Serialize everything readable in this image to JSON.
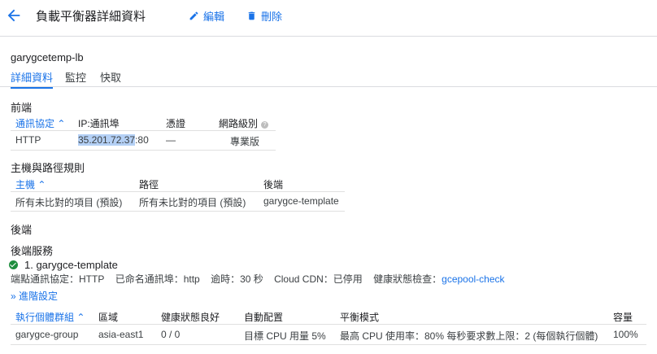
{
  "header": {
    "title": "負載平衡器詳細資料",
    "edit_label": "編輯",
    "delete_label": "刪除"
  },
  "lb_name": "garygcetemp-lb",
  "tabs": [
    "詳細資料",
    "監控",
    "快取"
  ],
  "frontend": {
    "heading": "前端",
    "columns": [
      "通訊協定",
      "IP:通訊埠",
      "憑證",
      "網路級別"
    ],
    "row": {
      "protocol": "HTTP",
      "ip": "35.201.72.37",
      "port": ":80",
      "cert": "—",
      "tier": "專業版"
    }
  },
  "host_rules": {
    "heading": "主機與路徑規則",
    "columns": [
      "主機",
      "路徑",
      "後端"
    ],
    "row": {
      "host": "所有未比對的項目 (預設)",
      "path": "所有未比對的項目 (預設)",
      "backend": "garygce-template"
    }
  },
  "backend": {
    "heading": "後端",
    "services_heading": "後端服務",
    "service_name": "1. garygce-template",
    "details": {
      "protocol": "端點通訊協定：HTTP",
      "port_name": "已命名通訊埠：http",
      "timeout": "逾時：30 秒",
      "cdn": "Cloud CDN：已停用",
      "health_label": "健康狀態檢查：",
      "health_link": "gcepool-check"
    },
    "advanced_link": "進階設定",
    "columns": [
      "執行個體群組",
      "區域",
      "健康狀態良好",
      "自動配置",
      "平衡模式",
      "容量"
    ],
    "row": {
      "group": "garygce-group",
      "zone": "asia-east1",
      "healthy": "0 / 0",
      "autoscale": "目標 CPU 用量 5%",
      "mode": "最高 CPU 使用率：80% 每秒要求數上限：2 (每個執行個體)",
      "capacity": "100%"
    }
  },
  "colors": {
    "accent": "#1a73e8",
    "healthy": "#1e8e3e"
  }
}
